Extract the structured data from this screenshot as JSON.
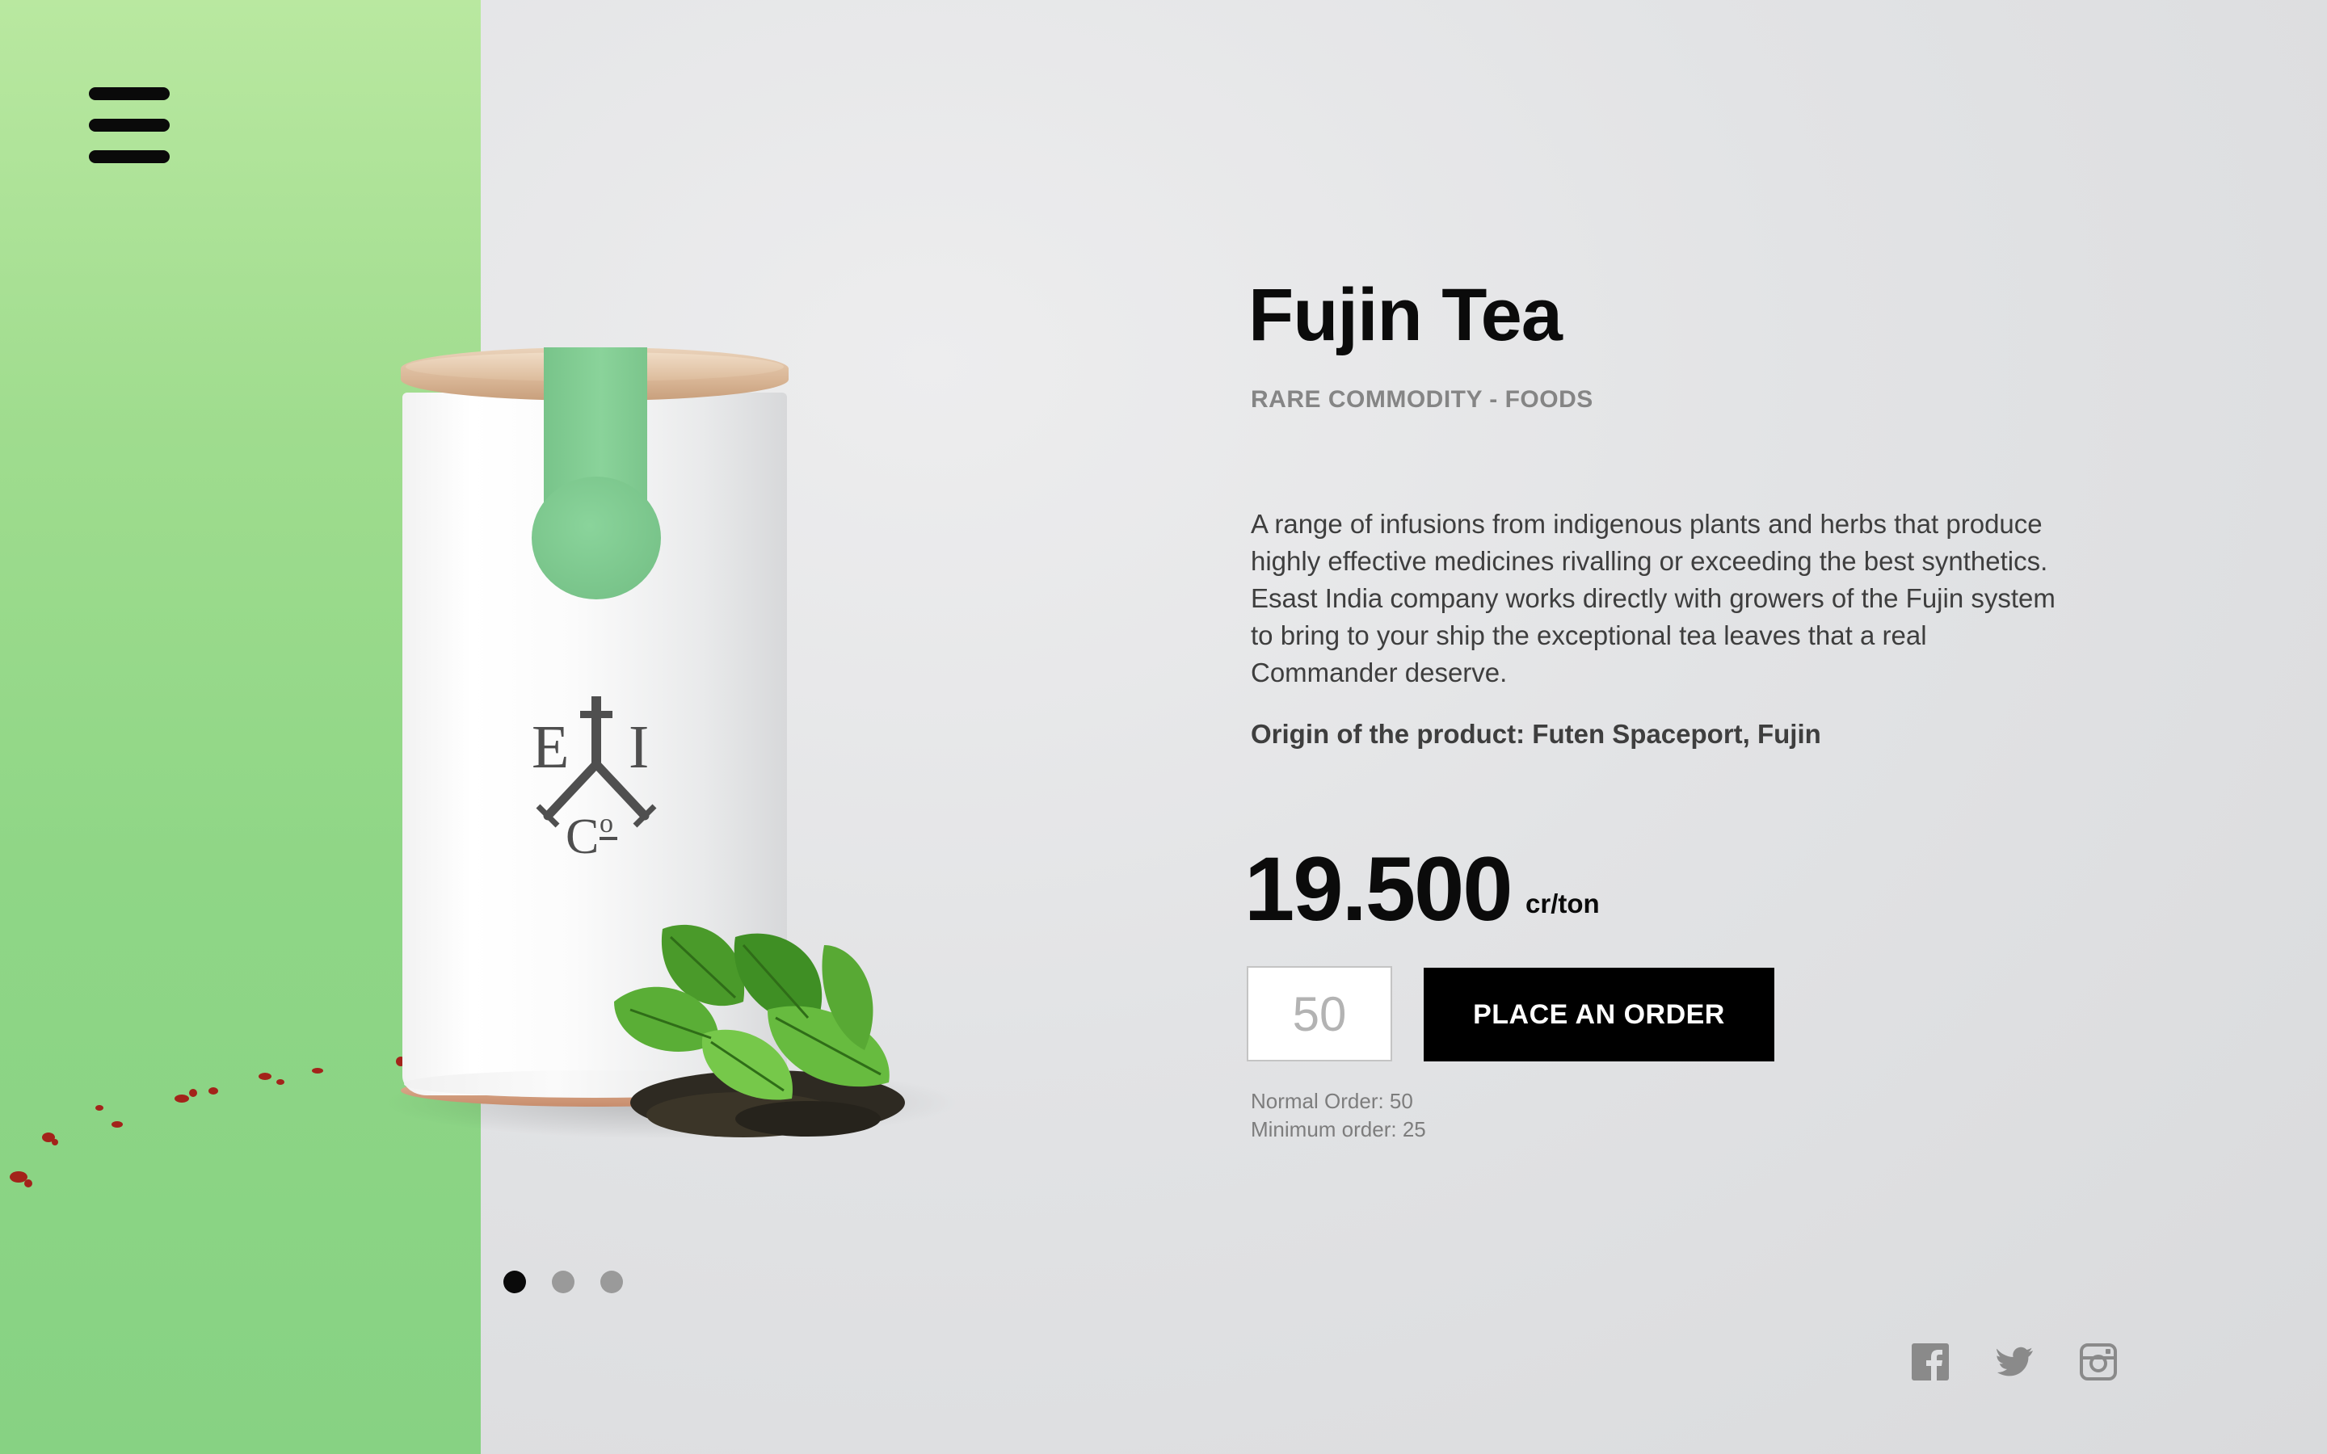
{
  "menu": {
    "icon": "hamburger-menu-icon"
  },
  "product": {
    "title": "Fujin Tea",
    "category": "RARE COMMODITY - FOODS",
    "description": "A range of infusions from indigenous plants and herbs that produce highly effective medicines rivalling or exceeding the best synthetics. Esast India company works directly with growers of the Fujin system to bring to your ship the exceptional tea leaves that a real Commander deserve.",
    "origin": "Origin of the product: Futen Spaceport, Fujin",
    "logo_text": "E I Co",
    "image": "tea-canister-with-leaves"
  },
  "price": {
    "value": "19.500",
    "unit": "cr/ton"
  },
  "order": {
    "quantity_value": "50",
    "button_label": "PLACE AN ORDER",
    "normal_order": "Normal Order: 50",
    "minimum_order": "Minimum order: 25"
  },
  "carousel": {
    "dots": 3,
    "active_index": 0
  },
  "social": [
    {
      "name": "facebook-icon"
    },
    {
      "name": "twitter-icon"
    },
    {
      "name": "instagram-icon"
    }
  ],
  "colors": {
    "accent_green": "#8fd686",
    "button_bg": "#000000",
    "text_dark": "#0b0b0b",
    "text_muted": "#858585"
  }
}
